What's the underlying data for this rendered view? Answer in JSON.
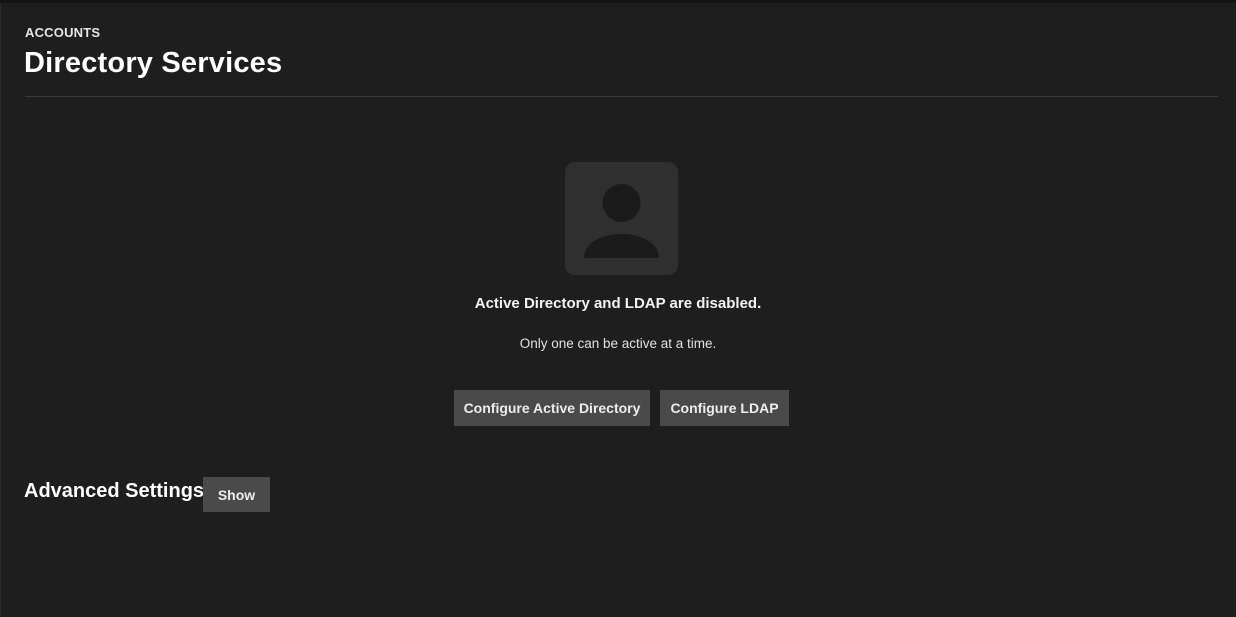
{
  "header": {
    "breadcrumb": "ACCOUNTS",
    "title": "Directory Services"
  },
  "empty_state": {
    "icon": "user-placeholder-icon",
    "title": "Active Directory and LDAP are disabled.",
    "subtitle": "Only one can be active at a time.",
    "buttons": {
      "configure_ad": "Configure Active Directory",
      "configure_ldap": "Configure LDAP"
    }
  },
  "advanced": {
    "heading": "Advanced Settings",
    "toggle_label": "Show"
  },
  "colors": {
    "background": "#1e1e1e",
    "card": "#2f2f2f",
    "button": "#4a4a4a",
    "icon": "#1b1b1b"
  }
}
